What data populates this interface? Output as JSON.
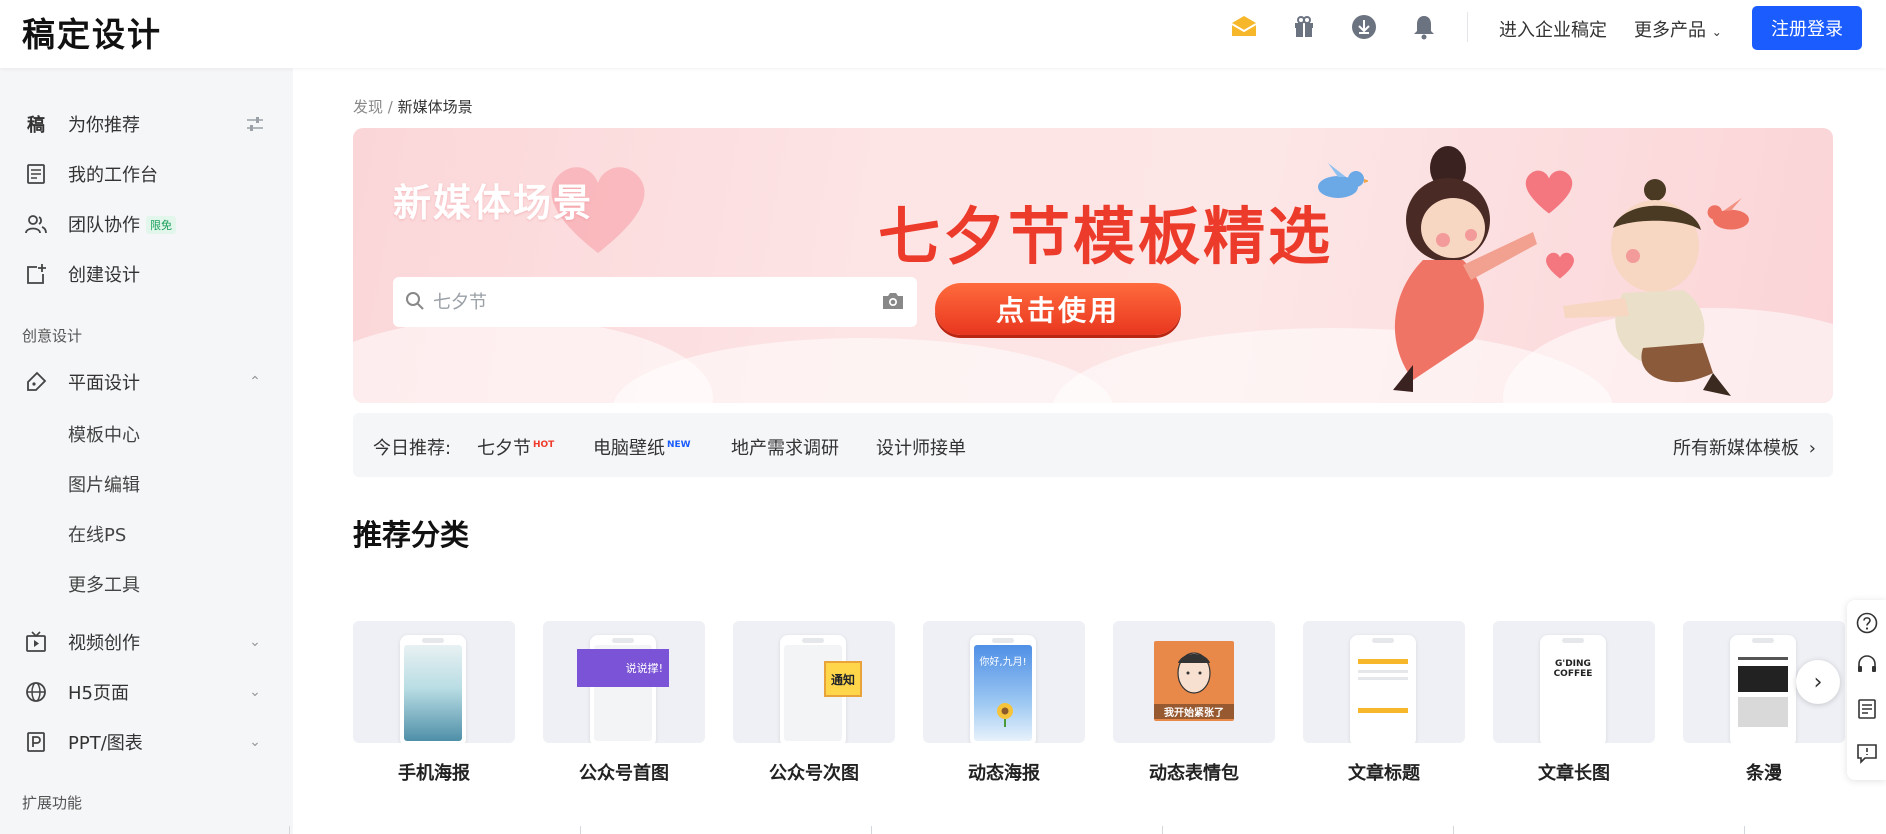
{
  "header": {
    "logo": "稿定设计",
    "enterprise_link": "进入企业稿定",
    "more_products": "更多产品",
    "login_button": "注册登录",
    "icons": [
      "vip-crown-icon",
      "gift-icon",
      "download-icon",
      "bell-icon"
    ]
  },
  "sidebar": {
    "top_items": [
      {
        "label": "为你推荐",
        "icon": "gao-logo-icon",
        "glyph": "稿"
      },
      {
        "label": "我的工作台",
        "icon": "workspace-icon"
      },
      {
        "label": "团队协作",
        "icon": "team-icon",
        "badge": "限免"
      },
      {
        "label": "创建设计",
        "icon": "create-icon"
      }
    ],
    "section_creative": "创意设计",
    "graphic_design": {
      "label": "平面设计",
      "icon": "pen-icon"
    },
    "graphic_sub": [
      "模板中心",
      "图片编辑",
      "在线PS",
      "更多工具"
    ],
    "more_items": [
      {
        "label": "视频创作",
        "icon": "video-icon"
      },
      {
        "label": "H5页面",
        "icon": "globe-icon"
      },
      {
        "label": "PPT/图表",
        "icon": "ppt-icon"
      }
    ],
    "section_extend": "扩展功能"
  },
  "breadcrumb": {
    "root": "发现",
    "separator": "/",
    "current": "新媒体场景"
  },
  "banner": {
    "title": "新媒体场景",
    "search_placeholder": "七夕节",
    "promo_title": "七夕节模板精选",
    "promo_button": "点击使用"
  },
  "recommend": {
    "label": "今日推荐:",
    "tags": [
      {
        "text": "七夕节",
        "badge": "HOT",
        "badge_color": "#f03a2b"
      },
      {
        "text": "电脑壁纸",
        "badge": "NEW",
        "badge_color": "#1b5cff"
      },
      {
        "text": "地产需求调研",
        "badge": ""
      },
      {
        "text": "设计师接单",
        "badge": ""
      }
    ],
    "all_link": "所有新媒体模板"
  },
  "categories": {
    "title": "推荐分类",
    "items": [
      {
        "label": "手机海报"
      },
      {
        "label": "公众号首图",
        "overlay": "说说撑!"
      },
      {
        "label": "公众号次图",
        "overlay": "通知"
      },
      {
        "label": "动态海报",
        "overlay": "你好,九月!"
      },
      {
        "label": "动态表情包",
        "overlay": "我开始紧张了"
      },
      {
        "label": "文章标题"
      },
      {
        "label": "文章长图",
        "overlay": "G'DING COFFEE"
      },
      {
        "label": "条漫"
      }
    ]
  },
  "float_icons": [
    "help-icon",
    "headset-icon",
    "feedback-icon",
    "message-icon"
  ],
  "colors": {
    "brand": "#1b5cff",
    "promo_red": "#ec3b2b",
    "sidebar_bg": "#f5f6f8"
  }
}
